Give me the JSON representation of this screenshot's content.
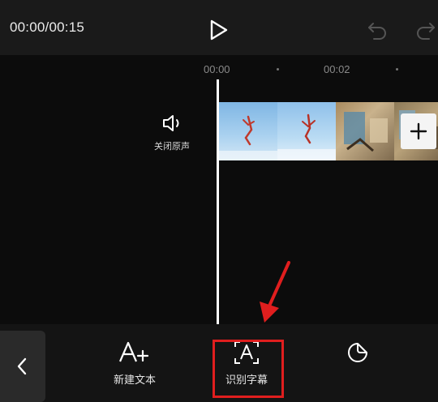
{
  "topbar": {
    "time_display": "00:00/00:15",
    "icons": [
      "play-icon",
      "undo-icon",
      "redo-icon"
    ]
  },
  "timeline": {
    "ticks": [
      "00:00",
      "00:02"
    ],
    "mute_label": "关闭原声",
    "add_icon": "plus-icon"
  },
  "toolbar": {
    "new_text_label": "新建文本",
    "recognize_subtitles_label": "识别字幕",
    "icons": [
      "chevron-left-icon",
      "text-add-icon",
      "text-recognize-icon",
      "sticker-icon"
    ]
  },
  "colors": {
    "highlight": "#e01e1e",
    "background": "#000000",
    "topbar": "#1a1a1a",
    "toolbar": "#141414"
  }
}
